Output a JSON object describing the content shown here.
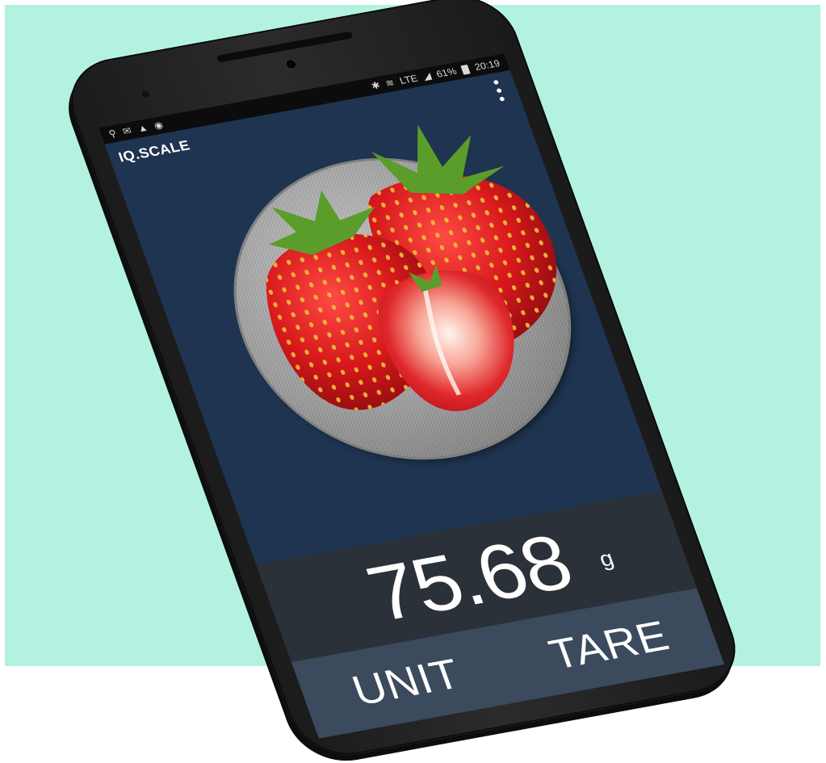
{
  "app": {
    "title": "IQ.SCALE"
  },
  "status_bar": {
    "battery_percent": "61%",
    "time": "20:19",
    "network": "LTE",
    "icons_left": [
      "location-icon",
      "mail-icon",
      "warning-icon",
      "sync-icon"
    ],
    "icons_right": [
      "bluetooth-icon",
      "wifi-icon",
      "signal-icon",
      "battery-icon"
    ]
  },
  "menu": {
    "icon": "overflow-menu-icon"
  },
  "scale": {
    "weight": "75.68",
    "unit": "g",
    "item": "strawberries"
  },
  "buttons": {
    "unit_label": "UNIT",
    "tare_label": "TARE"
  },
  "colors": {
    "background": "#b3f2e1",
    "screen": "#1f3450",
    "readout_panel": "#2b3138",
    "button_bar": "#3b4a5c",
    "text": "#ffffff"
  }
}
